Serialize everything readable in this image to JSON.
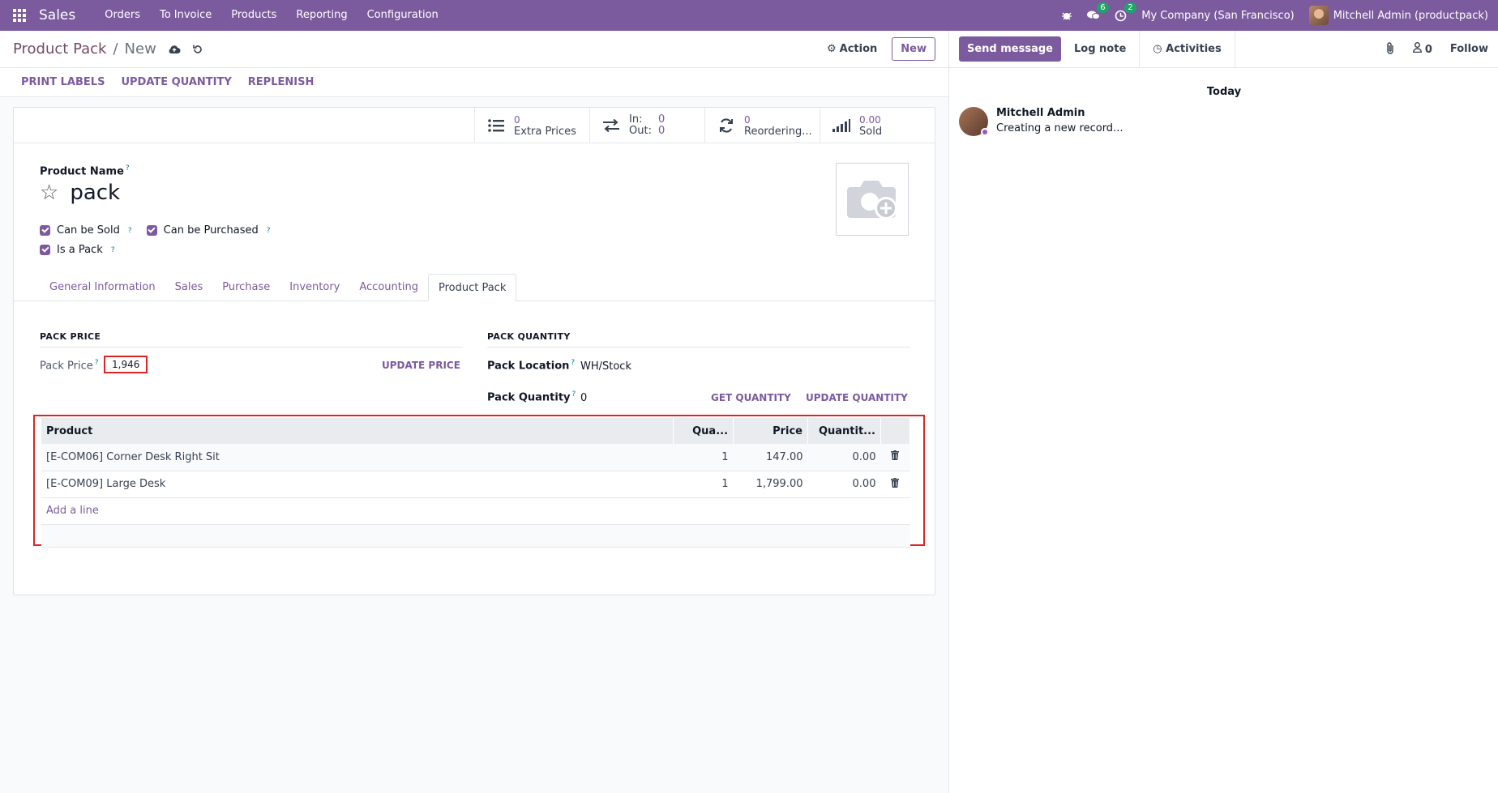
{
  "navbar": {
    "app_name": "Sales",
    "menu": [
      "Orders",
      "To Invoice",
      "Products",
      "Reporting",
      "Configuration"
    ],
    "messages_badge": "6",
    "activities_badge": "2",
    "company": "My Company (San Francisco)",
    "user": "Mitchell Admin (productpack)"
  },
  "control_panel": {
    "breadcrumb_parent": "Product Pack",
    "breadcrumb_sep": "/",
    "breadcrumb_current": "New",
    "action_label": "Action",
    "new_label": "New"
  },
  "statusbar": {
    "buttons": [
      "PRINT LABELS",
      "UPDATE QUANTITY",
      "REPLENISH"
    ]
  },
  "smart_buttons": {
    "extra_prices_value": "0",
    "extra_prices_label": "Extra Prices",
    "in_label": "In:",
    "in_value": "0",
    "out_label": "Out:",
    "out_value": "0",
    "reordering_value": "0",
    "reordering_label": "Reordering...",
    "sold_value": "0.00",
    "sold_label": "Sold"
  },
  "form": {
    "product_name_label": "Product Name",
    "product_name": "pack",
    "can_be_sold": "Can be Sold",
    "can_be_purchased": "Can be Purchased",
    "is_a_pack": "Is a Pack",
    "tabs": [
      "General Information",
      "Sales",
      "Purchase",
      "Inventory",
      "Accounting",
      "Product Pack"
    ],
    "pack_price_title": "PACK PRICE",
    "pack_price_label": "Pack Price",
    "pack_price_value": "1,946",
    "update_price": "UPDATE PRICE",
    "pack_quantity_title": "PACK QUANTITY",
    "pack_location_label": "Pack Location",
    "pack_location_value": "WH/Stock",
    "pack_quantity_label": "Pack Quantity",
    "pack_quantity_value": "0",
    "get_quantity": "GET QUANTITY",
    "update_quantity": "UPDATE QUANTITY"
  },
  "pack_lines": {
    "columns": [
      "Product",
      "Qua...",
      "Price",
      "Quantit..."
    ],
    "rows": [
      {
        "product": "[E-COM06] Corner Desk Right Sit",
        "qty": "1",
        "price": "147.00",
        "quantity": "0.00"
      },
      {
        "product": "[E-COM09] Large Desk",
        "qty": "1",
        "price": "1,799.00",
        "quantity": "0.00"
      }
    ],
    "add_line": "Add a line"
  },
  "chatter": {
    "send_message": "Send message",
    "log_note": "Log note",
    "activities": "Activities",
    "followers_count": "0",
    "follow": "Follow",
    "today": "Today",
    "author": "Mitchell Admin",
    "body": "Creating a new record..."
  },
  "colors": {
    "brand": "#7c5a9e",
    "highlight": "#e02424"
  }
}
